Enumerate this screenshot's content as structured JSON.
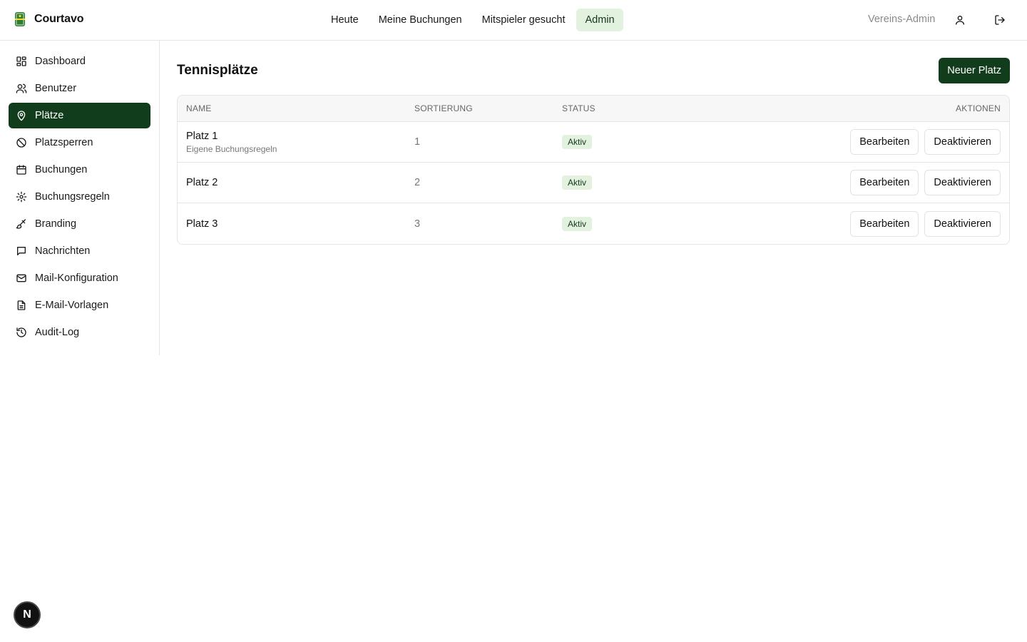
{
  "app": {
    "name": "Courtavo"
  },
  "topnav": {
    "items": [
      {
        "label": "Heute"
      },
      {
        "label": "Meine Buchungen"
      },
      {
        "label": "Mitspieler gesucht"
      },
      {
        "label": "Admin"
      }
    ],
    "active": "Admin",
    "role_label": "Vereins-Admin"
  },
  "sidebar": {
    "items": [
      {
        "label": "Dashboard",
        "icon": "dashboard-icon"
      },
      {
        "label": "Benutzer",
        "icon": "users-icon"
      },
      {
        "label": "Plätze",
        "icon": "map-pin-icon"
      },
      {
        "label": "Platzsperren",
        "icon": "ban-icon"
      },
      {
        "label": "Buchungen",
        "icon": "calendar-icon"
      },
      {
        "label": "Buchungsregeln",
        "icon": "gear-icon"
      },
      {
        "label": "Branding",
        "icon": "paintbrush-icon"
      },
      {
        "label": "Nachrichten",
        "icon": "message-icon"
      },
      {
        "label": "Mail-Konfiguration",
        "icon": "mail-icon"
      },
      {
        "label": "E-Mail-Vorlagen",
        "icon": "document-icon"
      },
      {
        "label": "Audit-Log",
        "icon": "history-icon"
      }
    ],
    "active": "Plätze"
  },
  "main": {
    "title": "Tennisplätze",
    "new_button": "Neuer Platz",
    "table": {
      "headers": {
        "name": "NAME",
        "sort": "SORTIERUNG",
        "status": "STATUS",
        "actions": "AKTIONEN"
      },
      "rows": [
        {
          "name": "Platz 1",
          "note": "Eigene Buchungsregeln",
          "sort": "1",
          "status": "Aktiv",
          "edit": "Bearbeiten",
          "deactivate": "Deaktivieren"
        },
        {
          "name": "Platz 2",
          "note": "",
          "sort": "2",
          "status": "Aktiv",
          "edit": "Bearbeiten",
          "deactivate": "Deaktivieren"
        },
        {
          "name": "Platz 3",
          "note": "",
          "sort": "3",
          "status": "Aktiv",
          "edit": "Bearbeiten",
          "deactivate": "Deaktivieren"
        }
      ]
    }
  },
  "fab": {
    "label": "N"
  },
  "colors": {
    "primary": "#123d1c",
    "active_tint": "#e3f1df",
    "border": "#e5e5e5"
  }
}
